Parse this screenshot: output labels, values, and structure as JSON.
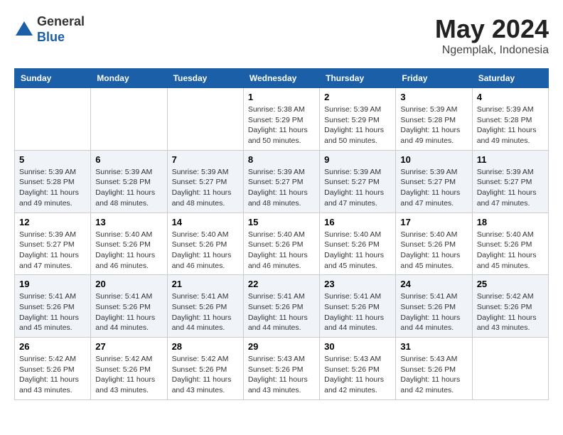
{
  "logo": {
    "general": "General",
    "blue": "Blue"
  },
  "title": {
    "month_year": "May 2024",
    "location": "Ngemplak, Indonesia"
  },
  "weekdays": [
    "Sunday",
    "Monday",
    "Tuesday",
    "Wednesday",
    "Thursday",
    "Friday",
    "Saturday"
  ],
  "weeks": [
    [
      {
        "day": "",
        "info": ""
      },
      {
        "day": "",
        "info": ""
      },
      {
        "day": "",
        "info": ""
      },
      {
        "day": "1",
        "info": "Sunrise: 5:38 AM\nSunset: 5:29 PM\nDaylight: 11 hours\nand 50 minutes."
      },
      {
        "day": "2",
        "info": "Sunrise: 5:39 AM\nSunset: 5:29 PM\nDaylight: 11 hours\nand 50 minutes."
      },
      {
        "day": "3",
        "info": "Sunrise: 5:39 AM\nSunset: 5:28 PM\nDaylight: 11 hours\nand 49 minutes."
      },
      {
        "day": "4",
        "info": "Sunrise: 5:39 AM\nSunset: 5:28 PM\nDaylight: 11 hours\nand 49 minutes."
      }
    ],
    [
      {
        "day": "5",
        "info": "Sunrise: 5:39 AM\nSunset: 5:28 PM\nDaylight: 11 hours\nand 49 minutes."
      },
      {
        "day": "6",
        "info": "Sunrise: 5:39 AM\nSunset: 5:28 PM\nDaylight: 11 hours\nand 48 minutes."
      },
      {
        "day": "7",
        "info": "Sunrise: 5:39 AM\nSunset: 5:27 PM\nDaylight: 11 hours\nand 48 minutes."
      },
      {
        "day": "8",
        "info": "Sunrise: 5:39 AM\nSunset: 5:27 PM\nDaylight: 11 hours\nand 48 minutes."
      },
      {
        "day": "9",
        "info": "Sunrise: 5:39 AM\nSunset: 5:27 PM\nDaylight: 11 hours\nand 47 minutes."
      },
      {
        "day": "10",
        "info": "Sunrise: 5:39 AM\nSunset: 5:27 PM\nDaylight: 11 hours\nand 47 minutes."
      },
      {
        "day": "11",
        "info": "Sunrise: 5:39 AM\nSunset: 5:27 PM\nDaylight: 11 hours\nand 47 minutes."
      }
    ],
    [
      {
        "day": "12",
        "info": "Sunrise: 5:39 AM\nSunset: 5:27 PM\nDaylight: 11 hours\nand 47 minutes."
      },
      {
        "day": "13",
        "info": "Sunrise: 5:40 AM\nSunset: 5:26 PM\nDaylight: 11 hours\nand 46 minutes."
      },
      {
        "day": "14",
        "info": "Sunrise: 5:40 AM\nSunset: 5:26 PM\nDaylight: 11 hours\nand 46 minutes."
      },
      {
        "day": "15",
        "info": "Sunrise: 5:40 AM\nSunset: 5:26 PM\nDaylight: 11 hours\nand 46 minutes."
      },
      {
        "day": "16",
        "info": "Sunrise: 5:40 AM\nSunset: 5:26 PM\nDaylight: 11 hours\nand 45 minutes."
      },
      {
        "day": "17",
        "info": "Sunrise: 5:40 AM\nSunset: 5:26 PM\nDaylight: 11 hours\nand 45 minutes."
      },
      {
        "day": "18",
        "info": "Sunrise: 5:40 AM\nSunset: 5:26 PM\nDaylight: 11 hours\nand 45 minutes."
      }
    ],
    [
      {
        "day": "19",
        "info": "Sunrise: 5:41 AM\nSunset: 5:26 PM\nDaylight: 11 hours\nand 45 minutes."
      },
      {
        "day": "20",
        "info": "Sunrise: 5:41 AM\nSunset: 5:26 PM\nDaylight: 11 hours\nand 44 minutes."
      },
      {
        "day": "21",
        "info": "Sunrise: 5:41 AM\nSunset: 5:26 PM\nDaylight: 11 hours\nand 44 minutes."
      },
      {
        "day": "22",
        "info": "Sunrise: 5:41 AM\nSunset: 5:26 PM\nDaylight: 11 hours\nand 44 minutes."
      },
      {
        "day": "23",
        "info": "Sunrise: 5:41 AM\nSunset: 5:26 PM\nDaylight: 11 hours\nand 44 minutes."
      },
      {
        "day": "24",
        "info": "Sunrise: 5:41 AM\nSunset: 5:26 PM\nDaylight: 11 hours\nand 44 minutes."
      },
      {
        "day": "25",
        "info": "Sunrise: 5:42 AM\nSunset: 5:26 PM\nDaylight: 11 hours\nand 43 minutes."
      }
    ],
    [
      {
        "day": "26",
        "info": "Sunrise: 5:42 AM\nSunset: 5:26 PM\nDaylight: 11 hours\nand 43 minutes."
      },
      {
        "day": "27",
        "info": "Sunrise: 5:42 AM\nSunset: 5:26 PM\nDaylight: 11 hours\nand 43 minutes."
      },
      {
        "day": "28",
        "info": "Sunrise: 5:42 AM\nSunset: 5:26 PM\nDaylight: 11 hours\nand 43 minutes."
      },
      {
        "day": "29",
        "info": "Sunrise: 5:43 AM\nSunset: 5:26 PM\nDaylight: 11 hours\nand 43 minutes."
      },
      {
        "day": "30",
        "info": "Sunrise: 5:43 AM\nSunset: 5:26 PM\nDaylight: 11 hours\nand 42 minutes."
      },
      {
        "day": "31",
        "info": "Sunrise: 5:43 AM\nSunset: 5:26 PM\nDaylight: 11 hours\nand 42 minutes."
      },
      {
        "day": "",
        "info": ""
      }
    ]
  ]
}
